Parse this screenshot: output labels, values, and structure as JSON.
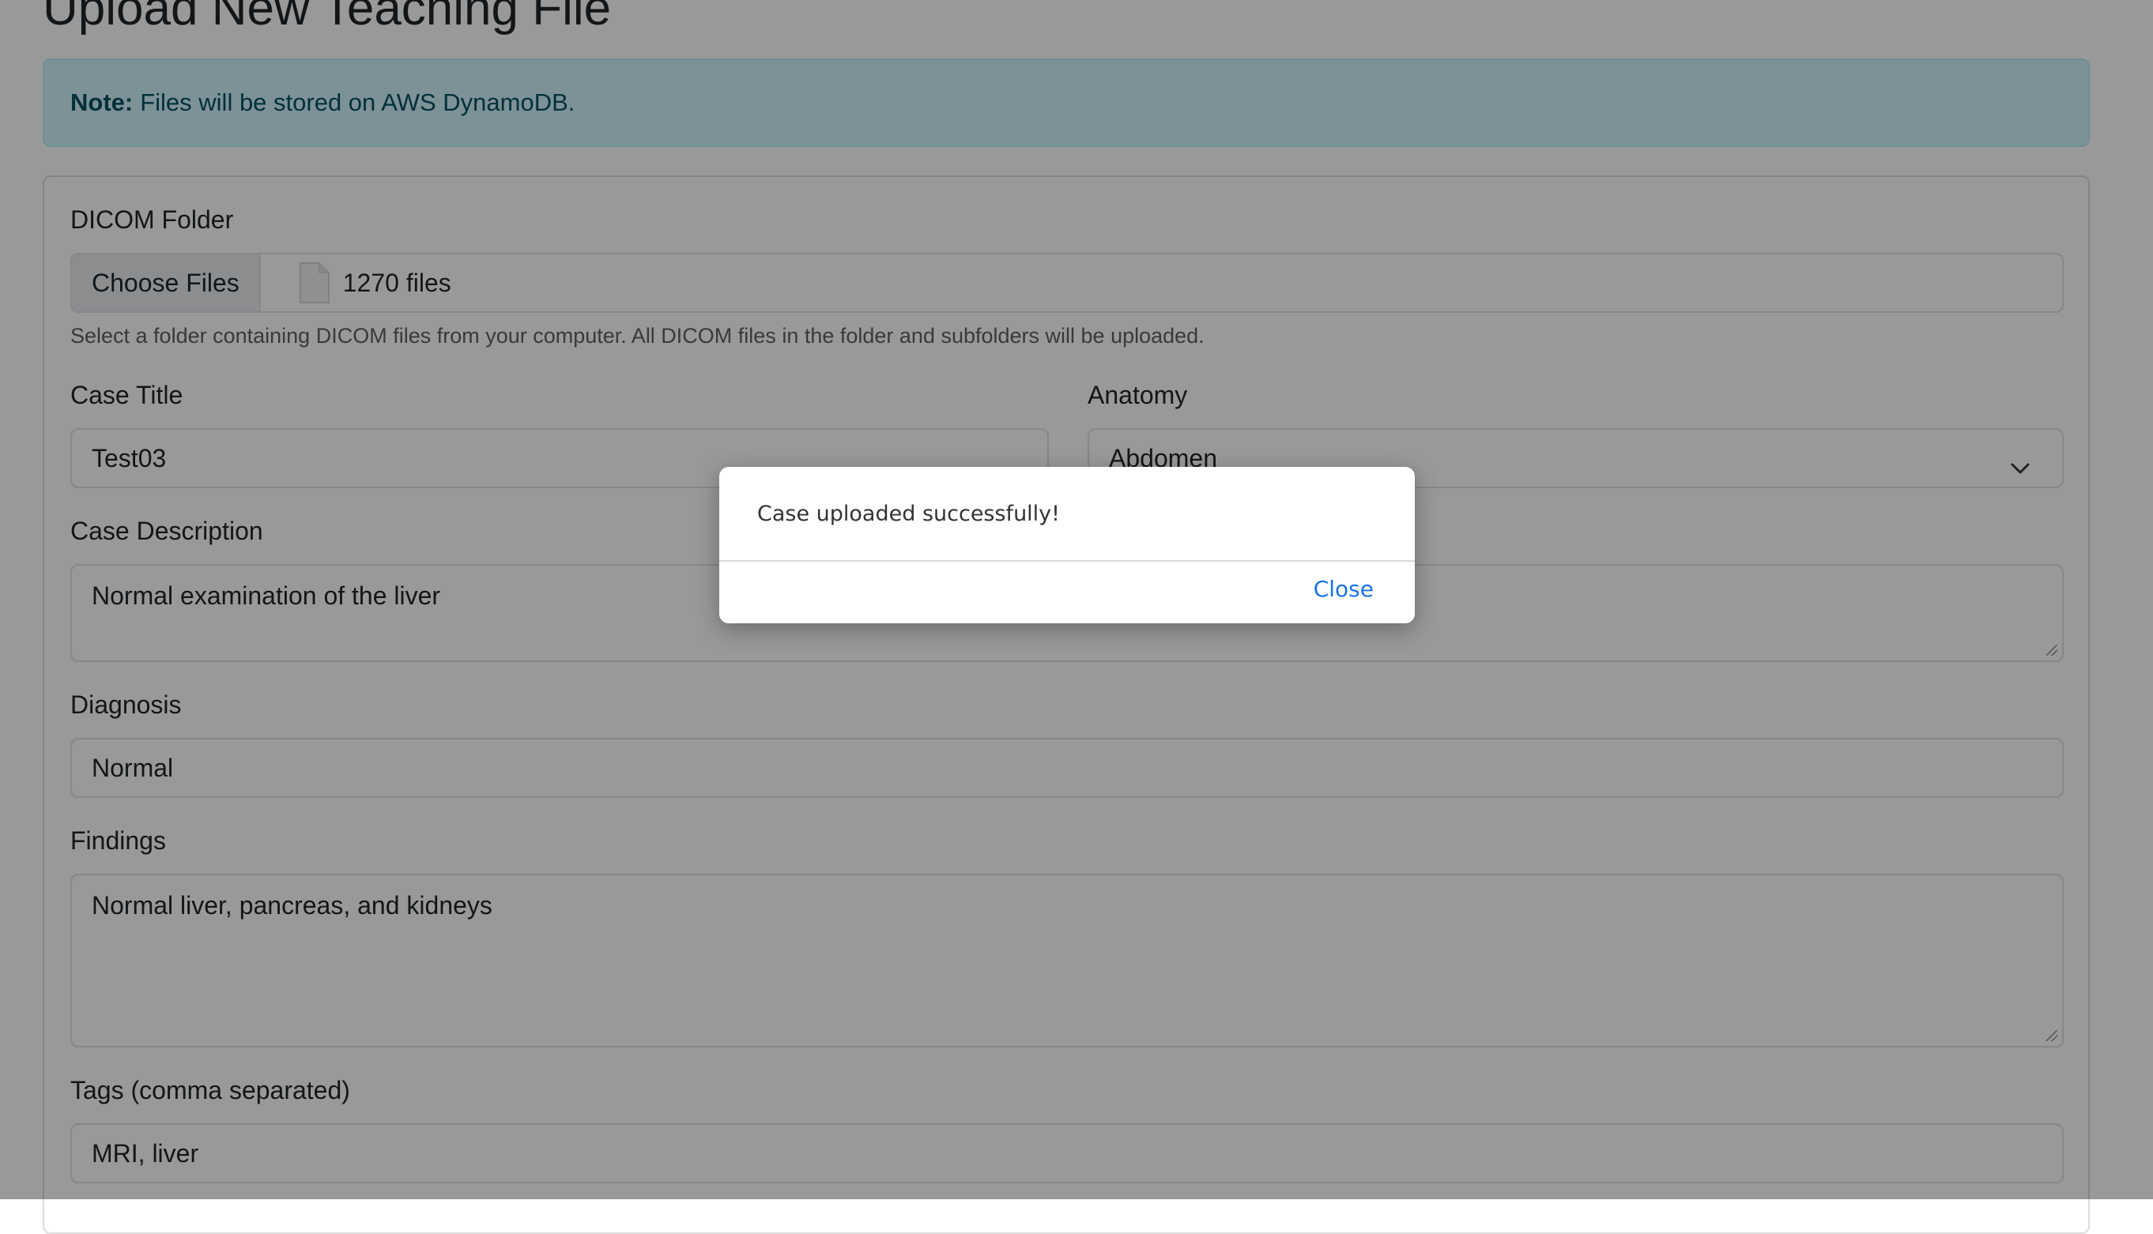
{
  "page": {
    "title": "Upload New Teaching File"
  },
  "alert": {
    "strong": "Note:",
    "text": "Files will be stored on AWS DynamoDB."
  },
  "form": {
    "dicom": {
      "label": "DICOM Folder",
      "button_label": "Choose Files",
      "file_icon": "file-icon",
      "selected_text": "1270 files",
      "help": "Select a folder containing DICOM files from your computer. All DICOM files in the folder and subfolders will be uploaded."
    },
    "case_title": {
      "label": "Case Title",
      "value": "Test03"
    },
    "anatomy": {
      "label": "Anatomy",
      "value": "Abdomen",
      "icon": "chevron-down-icon"
    },
    "case_description": {
      "label": "Case Description",
      "value": "Normal examination of the liver"
    },
    "diagnosis": {
      "label": "Diagnosis",
      "value": "Normal"
    },
    "findings": {
      "label": "Findings",
      "value": "Normal liver, pancreas, and kidneys"
    },
    "tags": {
      "label": "Tags (comma separated)",
      "value": "MRI, liver"
    }
  },
  "dialog": {
    "message": "Case uploaded successfully!",
    "close_label": "Close"
  },
  "colors": {
    "alert_background": "#cff4fc",
    "alert_text": "#055160",
    "dialog_link": "#1a73e8"
  }
}
